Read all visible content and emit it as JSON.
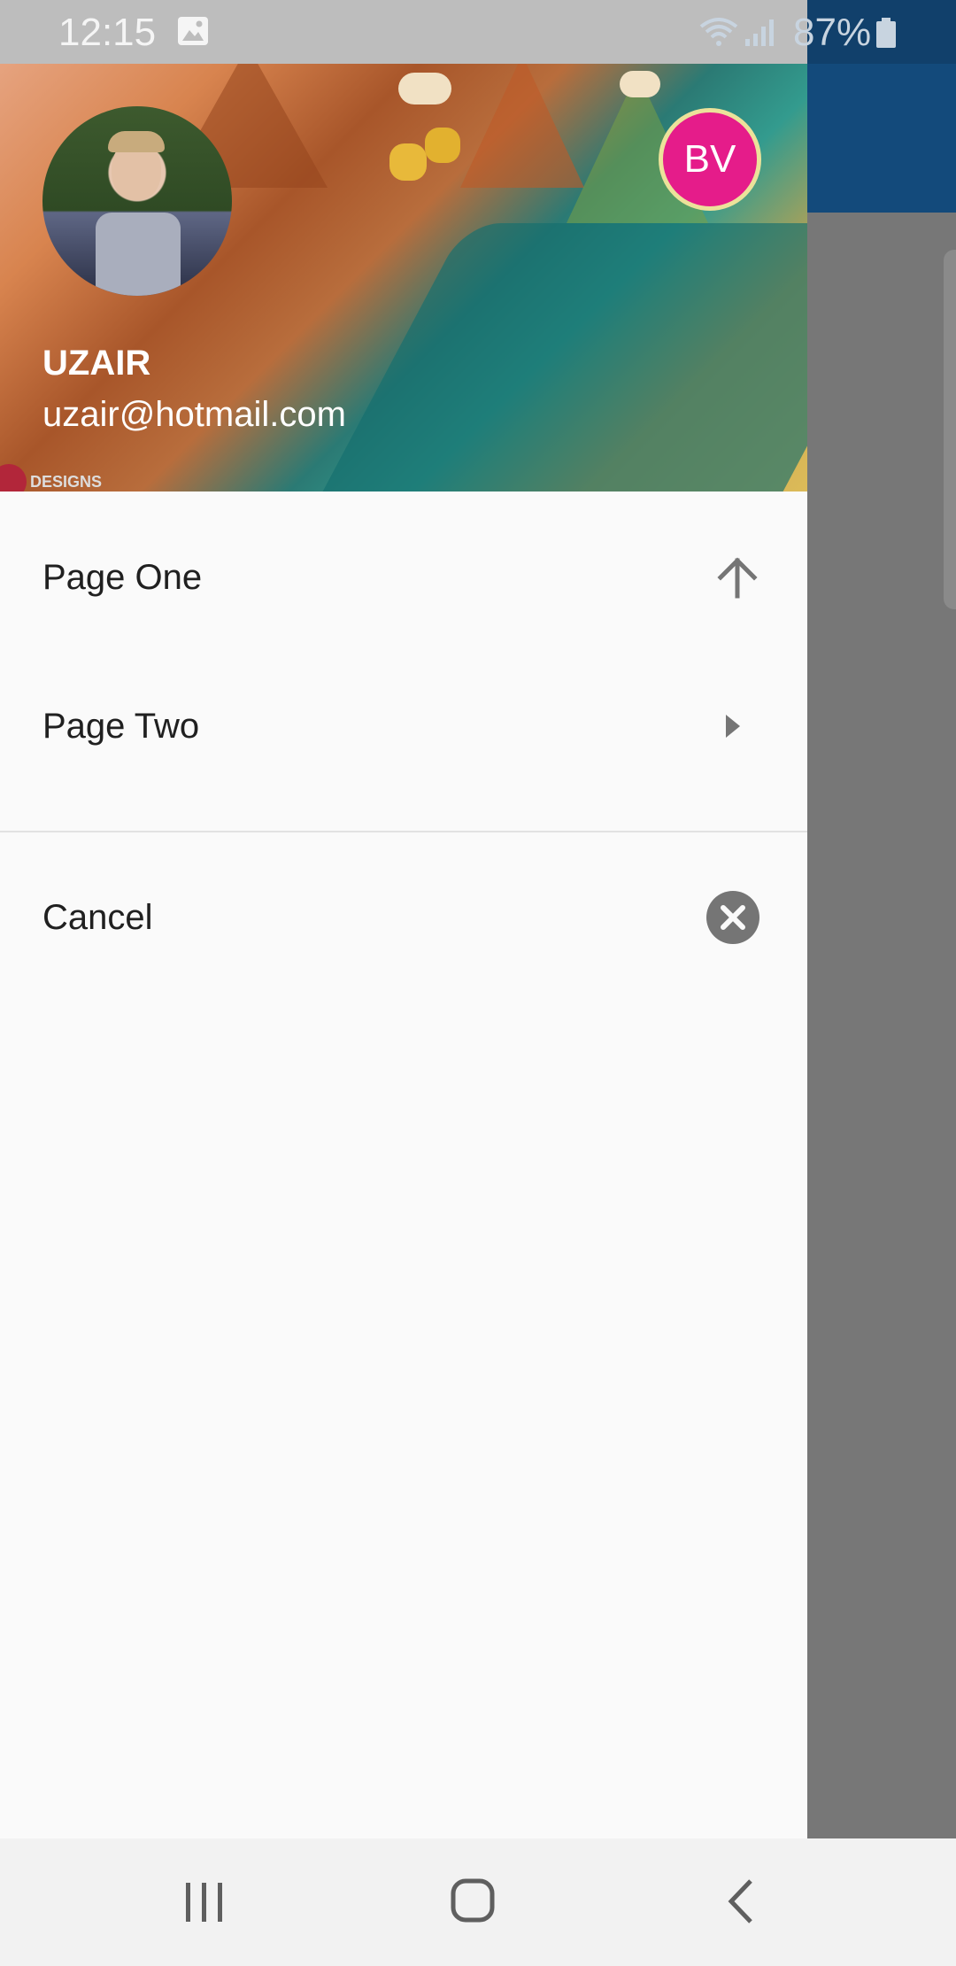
{
  "status_bar": {
    "time": "12:15",
    "battery": "87%"
  },
  "drawer": {
    "account": {
      "name": "UZAIR",
      "email": "uzair@hotmail.com",
      "other_account_initials": "BV"
    },
    "watermark": "DESIGNS",
    "items": [
      {
        "label": "Page One",
        "icon": "arrow-up-icon"
      },
      {
        "label": "Page Two",
        "icon": "arrow-right-icon"
      },
      {
        "label": "Cancel",
        "icon": "cancel-icon"
      }
    ]
  },
  "colors": {
    "app_bar": "#134a7b",
    "avatar_accent": "#e51c8a",
    "drawer_bg": "#fafafa",
    "scrim": "#737373"
  },
  "nav_bar": {
    "icons": [
      "recents-icon",
      "home-icon",
      "back-icon"
    ]
  }
}
